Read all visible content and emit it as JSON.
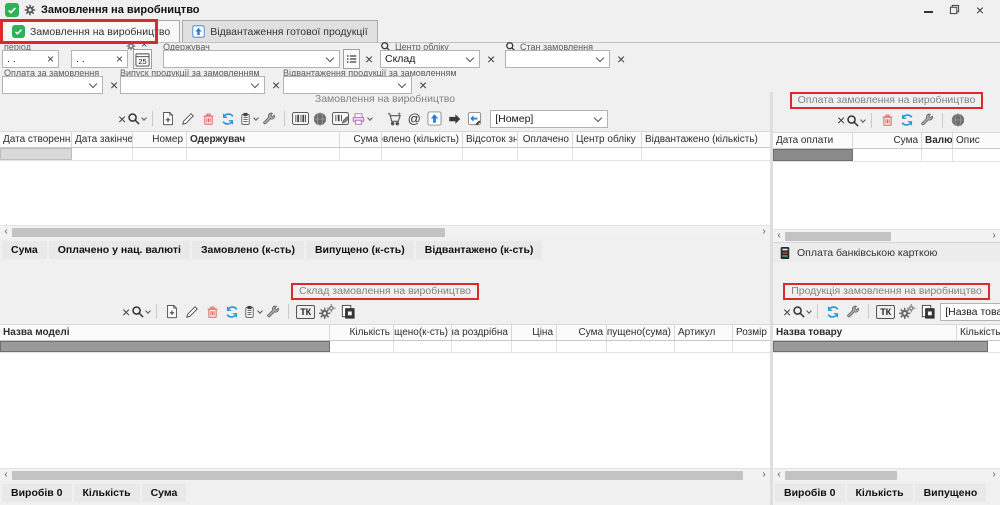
{
  "colors": {
    "annotation_red": "#d92b2b",
    "accent_green": "#2eb157",
    "refresh_blue": "#2596d1",
    "trash_red": "#e0635c",
    "printer_purple": "#a96cc0",
    "upload_blue": "#2d7dd2",
    "selected_cell_light": "#d9d9d9",
    "selected_cell_dark": "#8a8a8a"
  },
  "window": {
    "title": "Замовлення на виробництво"
  },
  "tabs": [
    {
      "label": "Замовлення на виробництво"
    },
    {
      "label": "Відвантаження готової продукції"
    }
  ],
  "filters": {
    "period_label": "період",
    "date_from": ". .",
    "date_to": ". .",
    "calendar_day": "25",
    "receiver_label": "Одержувач",
    "center_label": "Центр обліку",
    "center_value": "Склад",
    "state_label": "Стан замовлення",
    "payment_label": "Оплата за замовлення",
    "release_label": "Випуск продукції за замовленням",
    "shipment_label": "Відвантаження продукції за замовленням"
  },
  "orders": {
    "caption": "Замовлення на виробництво",
    "number_combo": "[Номер]",
    "columns": [
      "Дата створення",
      "Дата закінчення",
      "Номер",
      "Одержувач",
      "Сума",
      "Замовлено (кількість)",
      "Відсоток знижки",
      "Оплачено",
      "Центр обліку",
      "Відвантажено (кількість)"
    ],
    "footer": [
      "Сума",
      "Оплачено у нац. валюті",
      "Замовлено (к-сть)",
      "Випущено (к-сть)",
      "Відвантажено (к-сть)"
    ]
  },
  "payments": {
    "caption": "Оплата замовлення на виробництво",
    "columns": [
      "Дата оплати",
      "Сума",
      "Валюта",
      "Опис"
    ],
    "bank_card": "Оплата банківською карткою"
  },
  "composition": {
    "caption": "Склад замовлення на виробництво",
    "columns": [
      "Назва моделі",
      "Кількість",
      "Випущено(к-сть)",
      "Ціна роздрібна",
      "Ціна",
      "Сума",
      "Випущено(сума)",
      "Артикул",
      "Розмір"
    ],
    "footer_items_label": "Виробів",
    "footer_items_value": "0",
    "footer_qty": "Кількість",
    "footer_sum": "Сума"
  },
  "products": {
    "caption": "Продукція замовлення на виробництво",
    "name_combo": "[Назва товару]",
    "columns": [
      "Назва товару",
      "Кількість"
    ],
    "footer_items_label": "Виробів",
    "footer_items_value": "0",
    "footer_qty": "Кількість",
    "footer_out": "Випущено"
  },
  "toolbar": {
    "tk": "ТК",
    "at": "@"
  }
}
